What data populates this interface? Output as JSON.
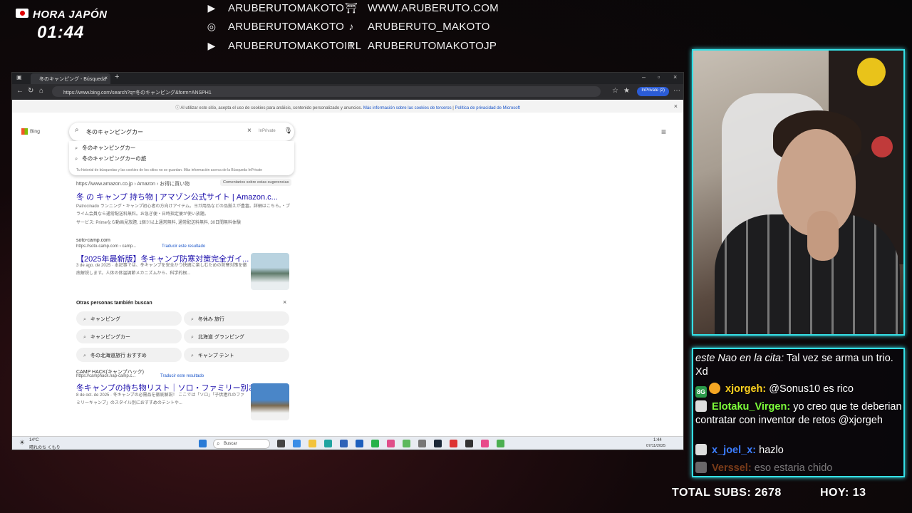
{
  "clock": {
    "label": "HORA JAPÓN",
    "time": "01:44"
  },
  "socials": [
    {
      "icon": "youtube-icon",
      "glyph": "▶",
      "text": "ARUBERUTOMAKOTO"
    },
    {
      "icon": "instagram-icon",
      "glyph": "◎",
      "text": "ARUBERUTOMAKOTO"
    },
    {
      "icon": "youtube-icon",
      "glyph": "▶",
      "text": "ARUBERUTOMAKOTOIRL"
    },
    {
      "icon": "torii-icon",
      "glyph": "⛩",
      "text": "WWW.ARUBERUTO.COM"
    },
    {
      "icon": "tiktok-icon",
      "glyph": "♪",
      "text": "ARUBERUTO_MAKOTO"
    },
    {
      "icon": "facebook-icon",
      "glyph": "f",
      "text": "ARUBERUTOMAKOTOJP"
    }
  ],
  "browser": {
    "tab_title": "冬のキャンピング - Búsqueda",
    "url": "https://www.bing.com/search?q=冬のキャンピング&form=ANSPH1",
    "inprivate": "InPrivate (2)",
    "cookie_text": "Al utilizar este sitio, acepta el uso de cookies para análisis, contenido personalizado y anuncios.",
    "cookie_link1": "Más información sobre las cookies de terceros",
    "cookie_link2": "Política de privacidad de Microsoft",
    "bing_logo": "Bing",
    "search_query": "冬のキャンピングカー",
    "search_inprivate": "InPrivate",
    "suggestions": [
      "冬のキャンピングカー",
      "冬のキャンピングカーの旅"
    ],
    "suggestion_note": "Tu historial de búsquedas y las cookies de los sitios no se guardan. Más información acerca de la Búsqueda InPrivate",
    "amazon_url": "https://www.amazon.co.jp › Amazon › お得に買い物",
    "feedback": "Comentarios sobre estas sugerencias",
    "amazon_title": "冬 の キャンプ 持ち物 | アマゾン公式サイト | Amazon.c...",
    "amazon_snip": "Patrocinado ランニング・キャンプ初心者の方向けアイテム。ヨガ用品などの品揃えが豊富。詳細はこちら。・プライム会員なら通常配送料無料。お急ぎ便・日時指定便が使い放題。",
    "amazon_service": "サービス: Primeなら動画見放題, 1個※以上通常無料, 通常配送料無料, 30日間無料体験",
    "soto_site": "soto-camp.com",
    "soto_url": "https://soto-camp.com › camp...",
    "translate": "Traducir este resultado",
    "soto_title": "【2025年最新版】冬キャンプ防寒対策完全ガイ...",
    "soto_snip": "3 de ago. de 2025 · 本記事では、冬キャンプを安全かつ快適に楽しむための防寒対策を徹底解説します。人体の体温調節メカニズムから、科学的根...",
    "people_heading": "Otras personas también buscan",
    "people": [
      "キャンピング",
      "冬休み 旅行",
      "キャンピングカー",
      "北海道 グランピング",
      "冬の北海道旅行 おすすめ",
      "キャンプ テント"
    ],
    "camphack_site": "CAMP HACK(キャンプハック)",
    "camphack_url": "https://camphack.nap-camp.c...",
    "camphack_title": "冬キャンプの持ち物リスト｜ソロ・ファミリー別お...",
    "camphack_snip": "8 de oct. de 2025 · 冬キャンプの必需品を徹底解説！ ここでは「ソロ」「子供連れのファミリーキャンプ」のスタイル別におすすめのテントや...",
    "weather_temp": "14°C",
    "weather_desc": "晴れのち くもり",
    "taskbar_search": "Buscar",
    "tray_time": "1:44",
    "tray_date": "07/11/2025"
  },
  "chat": [
    {
      "user": "este Nao en la cita:",
      "color": "#ffffff",
      "text": "Tal vez se arma un trio. Xd",
      "badge": ""
    },
    {
      "user": "xjorgeh:",
      "color": "#ffd21e",
      "text": "@Sonus10 es rico",
      "badge": "8G"
    },
    {
      "user": "Elotaku_Virgen:",
      "color": "#7dff3a",
      "text": "yo creo que te deberian contratar con inventor de retos @xjorgeh",
      "badge": "fox"
    },
    {
      "user": "x_joel_x:",
      "color": "#3c7dff",
      "text": "hazlo",
      "badge": "fox"
    },
    {
      "user": "Verssel:",
      "color": "#ff7a2a",
      "text": "eso estaria chido",
      "badge": "fox"
    }
  ],
  "stats": {
    "total_subs_label": "TOTAL SUBS: 2678",
    "today_label": "HOY: 13"
  }
}
